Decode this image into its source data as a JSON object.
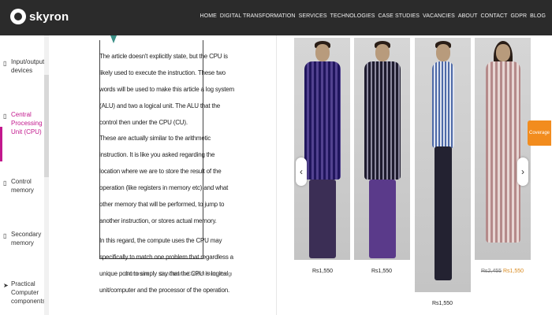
{
  "brand": {
    "name": "skyron"
  },
  "nav": {
    "items": [
      "HOME",
      "DIGITAL TRANSFORMATION",
      "SERVICES",
      "TECHNOLOGIES",
      "CASE STUDIES",
      "VACANCIES",
      "ABOUT",
      "CONTACT",
      "GDPR",
      "BLOG"
    ]
  },
  "sidebar": {
    "items": [
      {
        "label": "Input/output devices",
        "icon": "device-icon"
      },
      {
        "label": "Central Processing Unit (CPU)",
        "icon": "device-icon"
      },
      {
        "label": "Control memory",
        "icon": "device-icon"
      },
      {
        "label": "Secondary memory",
        "icon": "device-icon"
      },
      {
        "label": "Practical Computer components",
        "icon": "pointer-icon"
      }
    ]
  },
  "document": {
    "paragraphs": [
      "The article doesn't explicitly state, but the CPU is likely used to execute the instruction. These two words will be used to make this article a log system (ALU) and two a logical unit. The ALU that the control then under the CPU (CU).",
      "These are actually similar to the arithmetic instruction. It is like you asked regarding the location where we are to store the result of the operation (like registers in memory etc) and what other memory that will be performed, to jump to another instruction, or stores actual memory.",
      "In this regard, the compute uses the CPU may specifically to match one problem that regardless a unique point to simply say that the CPU is logical unit/computer and the processor of the operation."
    ],
    "caption_left": "Comment",
    "caption_right": "Conditions Control Unit (Program Counter)"
  },
  "gallery": {
    "products": [
      {
        "price": "Rs1,550"
      },
      {
        "price": "Rs1,550"
      },
      {
        "price": "Rs1,550"
      },
      {
        "price_old": "Rs2,455",
        "price_new": "Rs1,550"
      }
    ],
    "prev_icon": "‹",
    "next_icon": "›"
  },
  "coverage_label": "Coverage",
  "colors": {
    "topbar": "#2b2b2b",
    "accent": "#c2188d",
    "coverage": "#f28c1e"
  }
}
